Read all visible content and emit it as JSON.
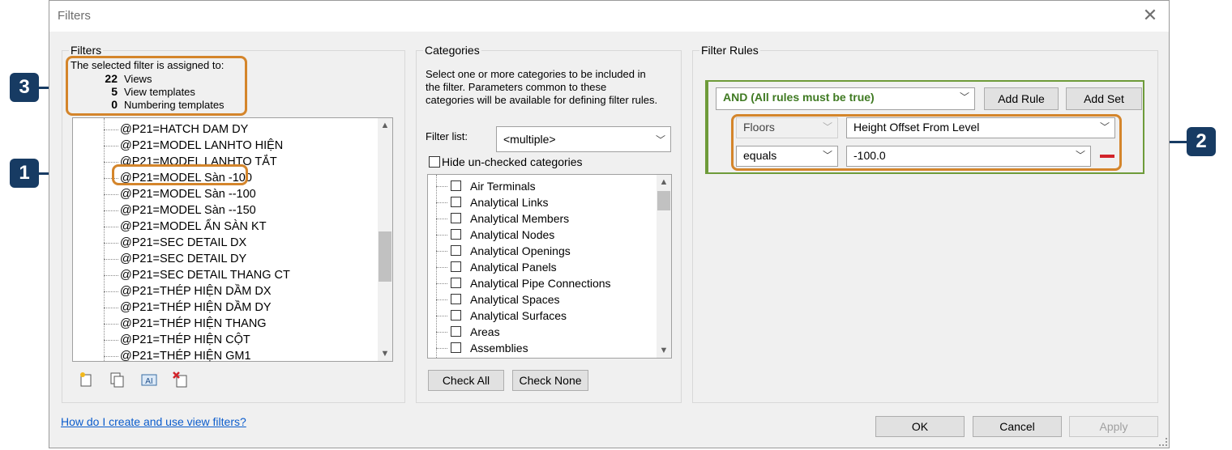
{
  "window": {
    "title": "Filters",
    "close_glyph": "✕"
  },
  "filters": {
    "group_label": "Filters",
    "assigned_heading": "The selected filter is assigned to:",
    "assigned": [
      {
        "count": "22",
        "label": "Views"
      },
      {
        "count": "5",
        "label": "View templates"
      },
      {
        "count": "0",
        "label": "Numbering templates"
      }
    ],
    "items": [
      "@P21=HATCH DAM DY",
      "@P21=MODEL LANHTO HIỆN",
      "@P21=MODEL LANHTO TẮT",
      "@P21=MODEL Sàn -100",
      "@P21=MODEL Sàn --100",
      "@P21=MODEL Sàn --150",
      "@P21=MODEL ẨN SÀN KT",
      "@P21=SEC DETAIL DX",
      "@P21=SEC DETAIL DY",
      "@P21=SEC DETAIL THANG CT",
      "@P21=THÉP  HIỆN  DẦM DX",
      "@P21=THÉP HIỆN  DẦM DY",
      "@P21=THÉP HIỆN  THANG",
      "@P21=THÉP HIỆN CỘT",
      "@P21=THÉP HIỆN GM1"
    ],
    "toolbar_icons": [
      "new-filter-icon",
      "duplicate-filter-icon",
      "rename-filter-icon",
      "delete-filter-icon"
    ]
  },
  "categories": {
    "group_label": "Categories",
    "description": [
      "Select one or more categories to be included in",
      "the filter.  Parameters common to these",
      "categories will be available for defining filter rules."
    ],
    "filter_list_label": "Filter list:",
    "filter_list_value": "<multiple>",
    "hide_unchecked_label": "Hide un-checked categories",
    "items": [
      "Air Terminals",
      "Analytical Links",
      "Analytical Members",
      "Analytical Nodes",
      "Analytical Openings",
      "Analytical Panels",
      "Analytical Pipe Connections",
      "Analytical Spaces",
      "Analytical Surfaces",
      "Areas",
      "Assemblies"
    ],
    "check_all": "Check All",
    "check_none": "Check None"
  },
  "rules": {
    "group_label": "Filter Rules",
    "logic": "AND (All rules must be true)",
    "add_rule": "Add Rule",
    "add_set": "Add Set",
    "category": "Floors",
    "parameter": "Height Offset From Level",
    "operator": "equals",
    "value": "-100.0"
  },
  "footer": {
    "help_link": "How do I create and use view filters?",
    "ok": "OK",
    "cancel": "Cancel",
    "apply": "Apply"
  },
  "callouts": [
    "1",
    "2",
    "3"
  ],
  "colors": {
    "accent_orange": "#d4852b",
    "callout_navy": "#173b63",
    "rule_green": "#6e9b3a",
    "link_blue": "#0b5ccc"
  }
}
